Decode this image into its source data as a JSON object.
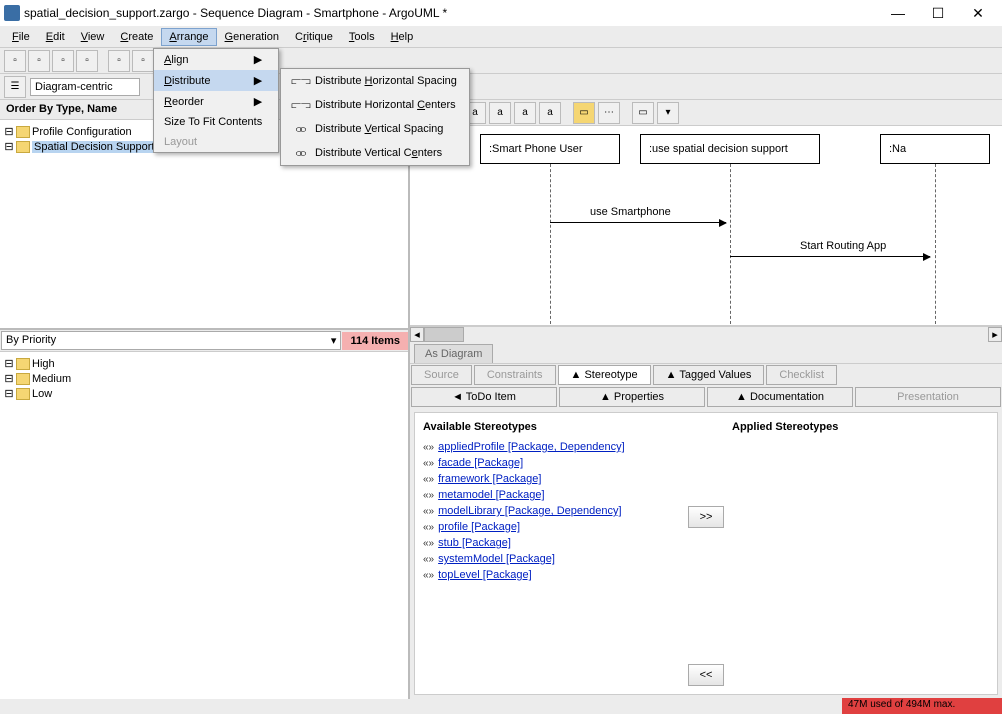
{
  "title": "spatial_decision_support.zargo - Sequence Diagram - Smartphone - ArgoUML *",
  "menu": {
    "file": "File",
    "edit": "Edit",
    "view": "View",
    "create": "Create",
    "arrange": "Arrange",
    "generation": "Generation",
    "critique": "Critique",
    "tools": "Tools",
    "help": "Help"
  },
  "arrange_menu": {
    "align": "Align",
    "distribute": "Distribute",
    "reorder": "Reorder",
    "size": "Size To Fit Contents",
    "layout": "Layout"
  },
  "distribute_sub": {
    "hs": "Distribute Horizontal Spacing",
    "hc": "Distribute Horizontal Centers",
    "vs": "Distribute Vertical Spacing",
    "vc": "Distribute Vertical Centers"
  },
  "toolbar2": {
    "mode": "Diagram-centric"
  },
  "explorer": {
    "header": "Order By Type, Name",
    "nodes": [
      "Profile Configuration",
      "Spatial Decision Support"
    ]
  },
  "priority": {
    "label": "By Priority",
    "count": "114 Items",
    "levels": [
      "High",
      "Medium",
      "Low"
    ]
  },
  "diagram": {
    "actor1": ":Smart Phone User",
    "actor2": ":use spatial decision support",
    "actor3": ":Na",
    "msg1": "use Smartphone",
    "msg2": "Start Routing App",
    "tab": "As Diagram"
  },
  "tabs": {
    "source": "Source",
    "constraints": "Constraints",
    "stereotype": "▲ Stereotype",
    "tagged": "▲ Tagged Values",
    "checklist": "Checklist",
    "todo": "◄ ToDo Item",
    "properties": "▲ Properties",
    "documentation": "▲ Documentation",
    "presentation": "Presentation"
  },
  "stereo": {
    "avail": "Available Stereotypes",
    "applied": "Applied Stereotypes",
    "items": [
      "appliedProfile [Package, Dependency]",
      "facade [Package]",
      "framework [Package]",
      "metamodel [Package]",
      "modelLibrary [Package, Dependency]",
      "profile [Package]",
      "stub [Package]",
      "systemModel [Package]",
      "topLevel [Package]"
    ],
    "add": ">>",
    "remove": "<<"
  },
  "status": {
    "mem": "47M used of 494M max."
  }
}
